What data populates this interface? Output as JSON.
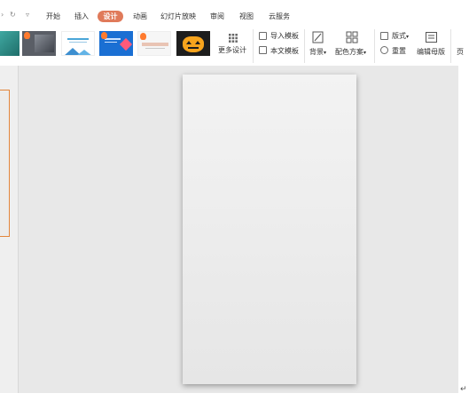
{
  "quick_access": {
    "undo_icon": "undo-icon",
    "redo_icon": "redo-icon",
    "more_icon": "chevron-down-icon"
  },
  "tabs": [
    {
      "label": "开始",
      "active": false
    },
    {
      "label": "插入",
      "active": false
    },
    {
      "label": "设计",
      "active": true
    },
    {
      "label": "动画",
      "active": false
    },
    {
      "label": "幻灯片放映",
      "active": false
    },
    {
      "label": "审阅",
      "active": false
    },
    {
      "label": "视图",
      "active": false
    },
    {
      "label": "云服务",
      "active": false
    }
  ],
  "ribbon": {
    "more_designs_label": "更多设计",
    "import_template_label": "导入模板",
    "this_template_label": "本文模板",
    "background_label": "背景",
    "color_scheme_label": "配色方案",
    "layout_label": "版式",
    "reset_label": "重置",
    "edit_master_label": "编辑母版",
    "page_setup_partial": "页"
  },
  "colors": {
    "accent": "#e07a5a",
    "selection_outline": "#e2853c",
    "workspace": "#e8e8e8"
  },
  "statusbar": {
    "return_symbol": "↵"
  }
}
